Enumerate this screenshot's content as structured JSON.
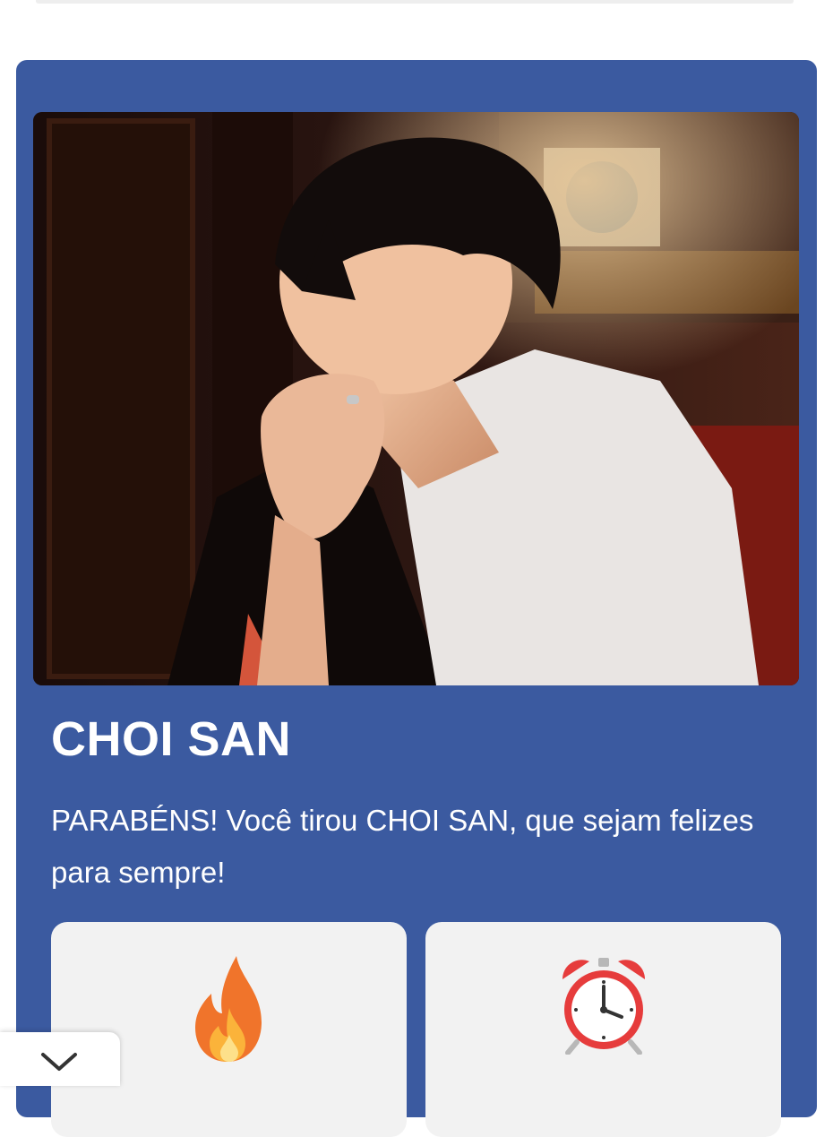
{
  "result": {
    "title": "CHOI SAN",
    "message": "PARABÉNS! Você tirou CHOI SAN, que sejam felizes para sempre!"
  },
  "stats": [
    {
      "icon": "fire-icon"
    },
    {
      "icon": "alarm-clock-icon"
    }
  ],
  "colors": {
    "card_background": "#3b5aa0",
    "stat_card_background": "#f2f2f2",
    "text": "#ffffff"
  },
  "collapse": {
    "icon": "chevron-down-icon"
  }
}
